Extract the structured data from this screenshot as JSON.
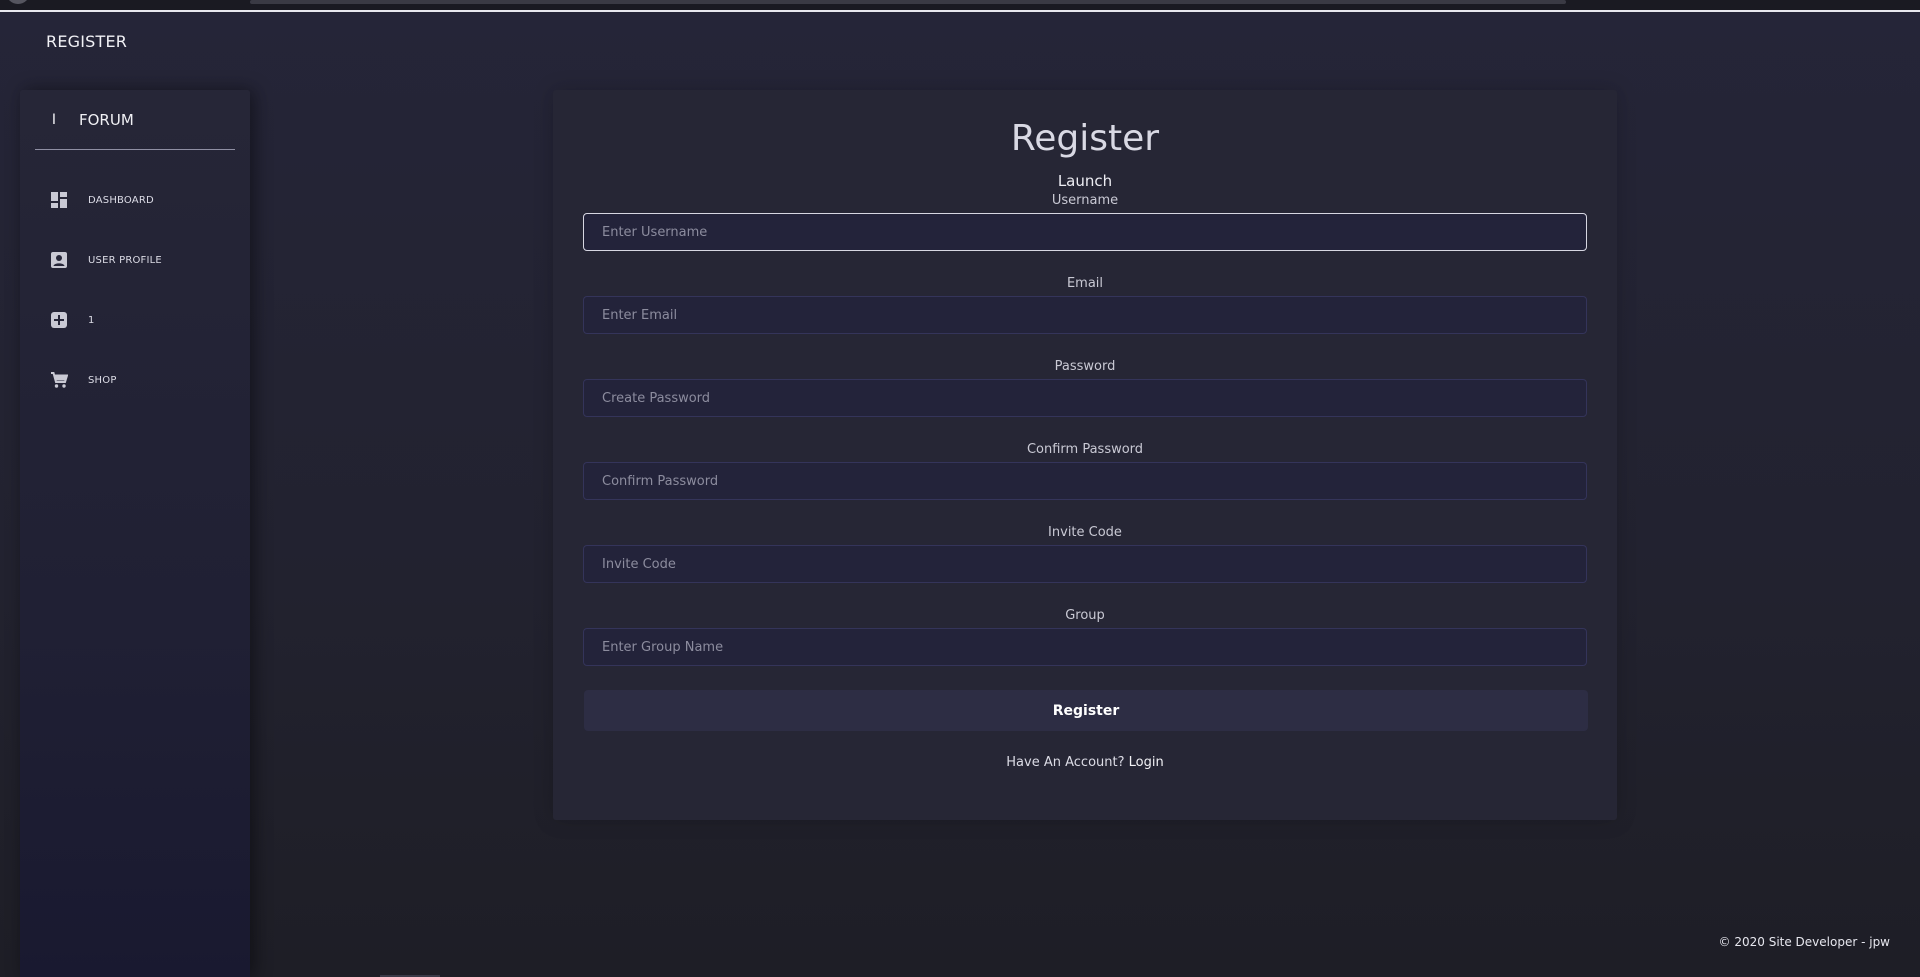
{
  "header": {
    "title": "REGISTER"
  },
  "sidebar": {
    "brand_mark": "I",
    "brand_label": "FORUM",
    "items": [
      {
        "label": "DASHBOARD",
        "icon": "dashboard-icon"
      },
      {
        "label": "USER PROFILE",
        "icon": "user-profile-icon"
      },
      {
        "label": "1",
        "icon": "add-box-icon"
      },
      {
        "label": "SHOP",
        "icon": "cart-icon"
      }
    ]
  },
  "form": {
    "title": "Register",
    "subtitle": "Launch",
    "fields": [
      {
        "label": "Username",
        "placeholder": "Enter Username",
        "value": ""
      },
      {
        "label": "Email",
        "placeholder": "Enter Email",
        "value": ""
      },
      {
        "label": "Password",
        "placeholder": "Create Password",
        "value": ""
      },
      {
        "label": "Confirm Password",
        "placeholder": "Confirm Password",
        "value": ""
      },
      {
        "label": "Invite Code",
        "placeholder": "Invite Code",
        "value": ""
      },
      {
        "label": "Group",
        "placeholder": "Enter Group Name",
        "value": ""
      }
    ],
    "submit_label": "Register",
    "account_prompt": "Have An Account?",
    "login_link": "Login"
  },
  "footer": {
    "text": "© 2020 Site Developer - jpw"
  },
  "colors": {
    "background": "#22222f",
    "card": "#262635",
    "input_bg": "#23233a",
    "input_border": "#34345a",
    "button": "#2d2d44"
  }
}
